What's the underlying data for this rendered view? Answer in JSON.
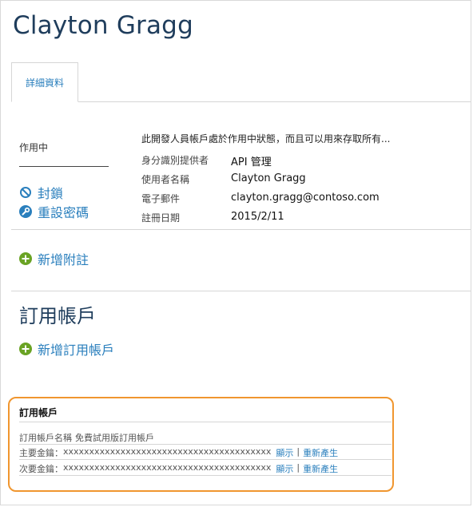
{
  "header": {
    "title": "Clayton Gragg"
  },
  "tabs": [
    {
      "label": "詳細資料"
    }
  ],
  "left": {
    "status": "作用中",
    "actions": {
      "block": "封鎖",
      "reset_password": "重設密碼",
      "add_note": "新增附註"
    }
  },
  "info": {
    "description": "此開發人員帳戶處於作用中狀態，而且可以用來存取所有...",
    "rows": [
      {
        "key": "身分識別提供者",
        "value": "API 管理"
      },
      {
        "key": "使用者名稱",
        "value": "Clayton Gragg"
      },
      {
        "key": "電子郵件",
        "value": "clayton.gragg@contoso.com"
      },
      {
        "key": "註冊日期",
        "value": "2015/2/11"
      }
    ]
  },
  "subscriptions": {
    "section_title": "訂用帳戶",
    "add_label": "新增訂用帳戶",
    "card": {
      "title": "訂用帳戶",
      "name_label": "訂用帳戶名稱",
      "name_value": "免費試用版訂用帳戶",
      "primary_label": "主要金鑰：",
      "secondary_label": "次要金鑰：",
      "masked_key": "xxxxxxxxxxxxxxxxxxxxxxxxxxxxxxxxxxxxxxxx",
      "show_label": "顯示",
      "separator": "|",
      "regenerate_label": "重新產生"
    }
  },
  "colors": {
    "accent": "#2a7fbd",
    "title": "#1f3d5c",
    "highlight": "#f0962f",
    "add_icon": "#6aa324"
  }
}
